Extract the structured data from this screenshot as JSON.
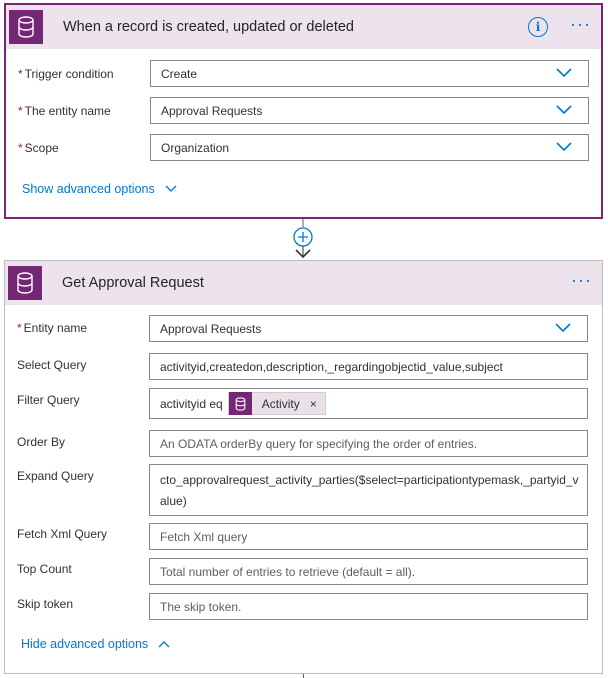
{
  "trigger_card": {
    "title": "When a record is created, updated or deleted",
    "info_label": "i",
    "more_label": "···",
    "fields": [
      {
        "label": "Trigger condition",
        "value": "Create",
        "required": true
      },
      {
        "label": "The entity name",
        "value": "Approval Requests",
        "required": true
      },
      {
        "label": "Scope",
        "value": "Organization",
        "required": true
      }
    ],
    "advanced_link": "Show advanced options"
  },
  "get_card": {
    "title": "Get Approval Request",
    "more_label": "···",
    "entity_name": {
      "label": "Entity name",
      "value": "Approval Requests",
      "required": true
    },
    "select_query": {
      "label": "Select Query",
      "value": "activityid,createdon,description,_regardingobjectid_value,subject"
    },
    "filter_query": {
      "label": "Filter Query",
      "prefix": "activityid eq",
      "token": "Activity",
      "token_close": "×"
    },
    "order_by": {
      "label": "Order By",
      "placeholder": "An ODATA orderBy query for specifying the order of entries."
    },
    "expand_query": {
      "label": "Expand Query",
      "value_line1": "cto_approvalrequest_activity_parties($select=participationtypemask,_partyid_v",
      "value_line2": "alue)"
    },
    "fetch_xml": {
      "label": "Fetch Xml Query",
      "placeholder": "Fetch Xml query"
    },
    "top_count": {
      "label": "Top Count",
      "placeholder": "Total number of entries to retrieve (default = all)."
    },
    "skip_token": {
      "label": "Skip token",
      "placeholder": "The skip token."
    },
    "advanced_link": "Hide advanced options"
  },
  "required_mark": "*",
  "colors": {
    "accent": "#742774",
    "header_bg": "#ece3ec",
    "link": "#0078d4"
  },
  "icons": [
    "database-icon",
    "info-icon",
    "more-icon",
    "chevron-down-icon",
    "chevron-up-icon",
    "add-step-icon",
    "arrow-down-icon",
    "close-icon"
  ]
}
